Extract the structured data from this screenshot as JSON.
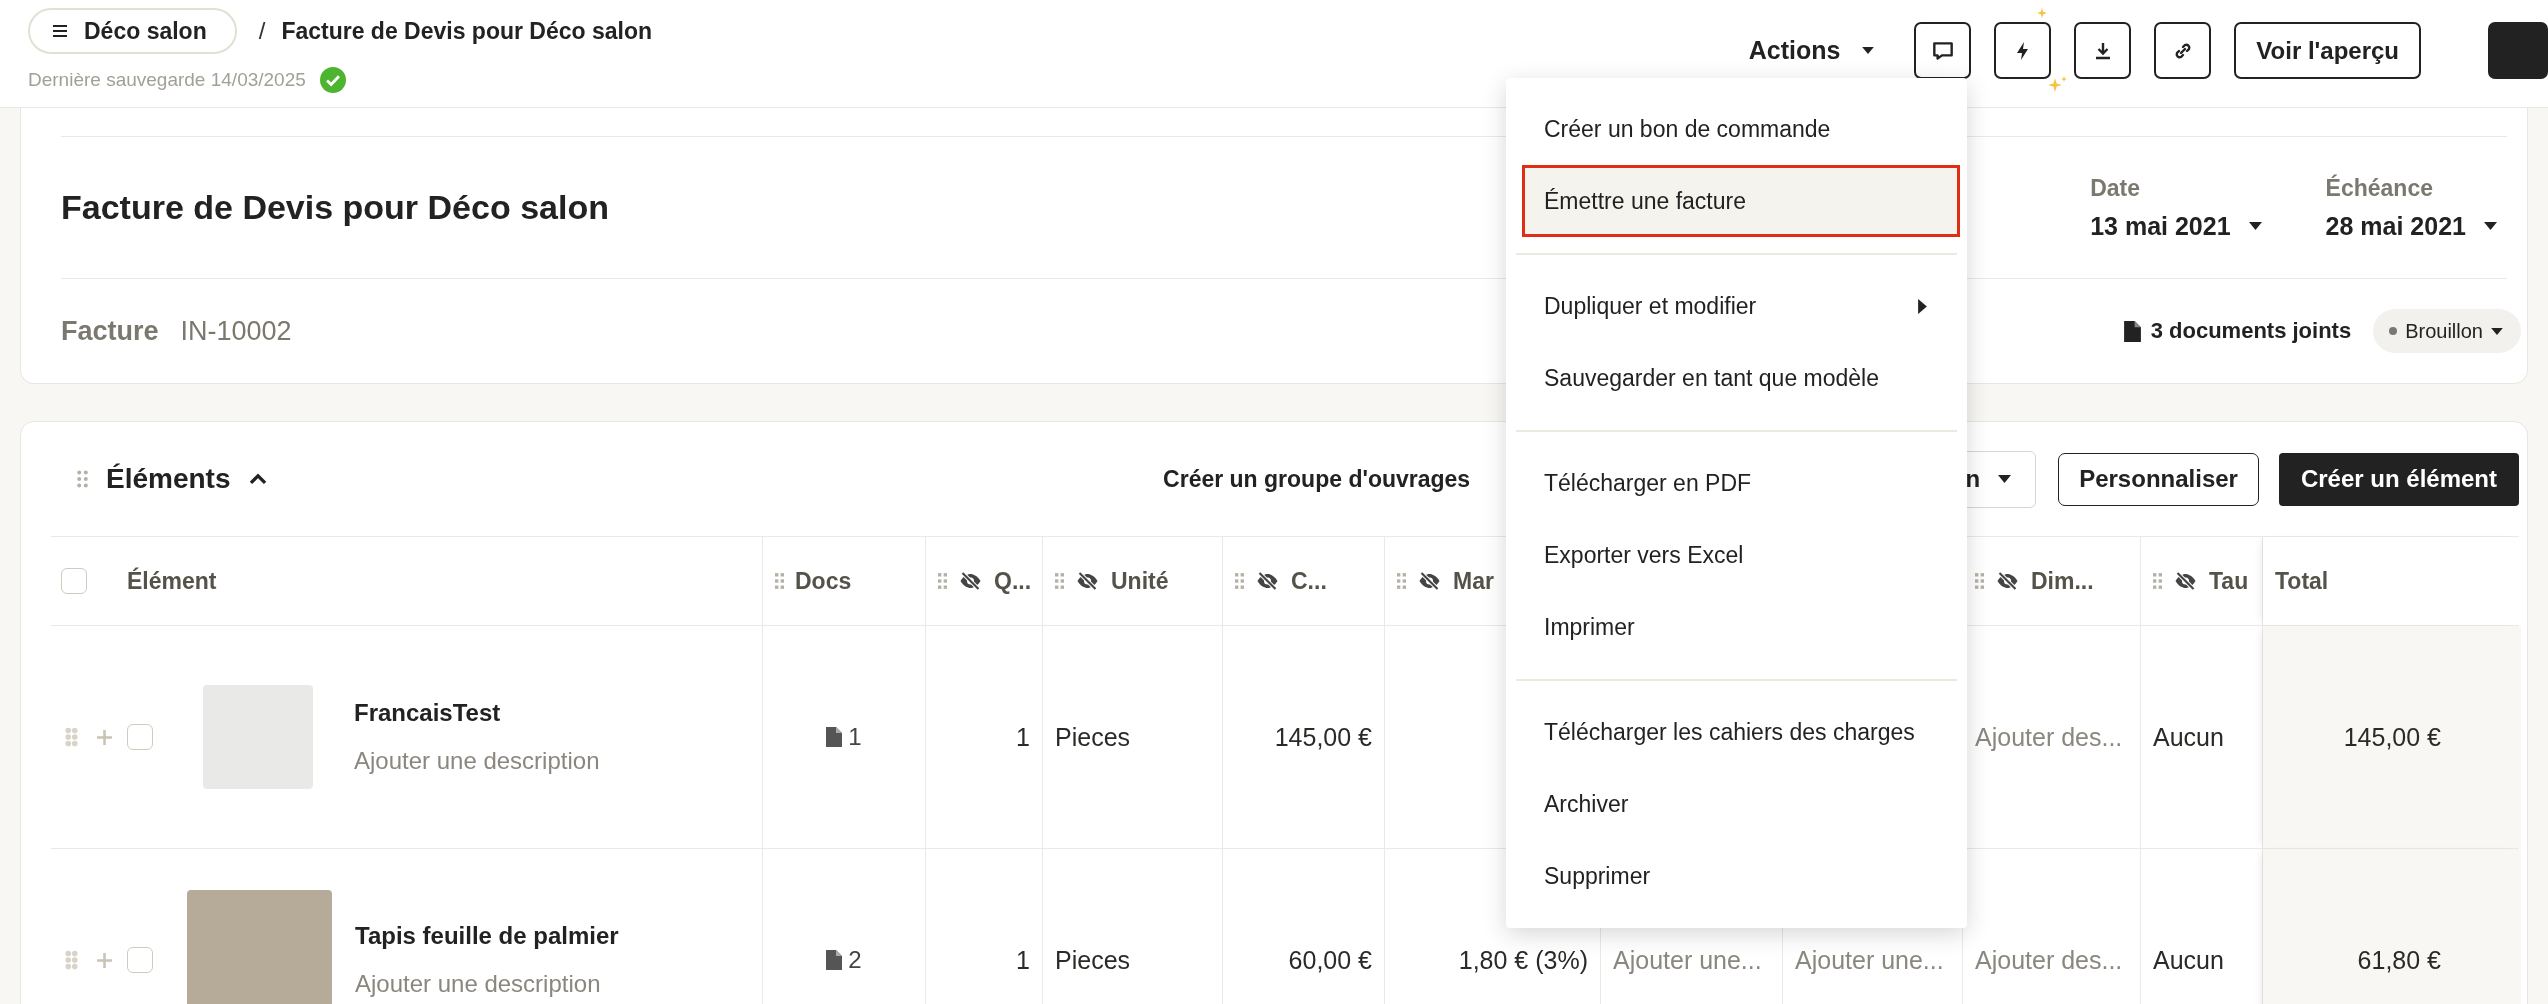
{
  "breadcrumb": {
    "project": "Déco salon",
    "separator": "/",
    "page": "Facture de Devis pour Déco salon"
  },
  "save_status": {
    "text": "Dernière sauvegarde 14/03/2025",
    "saved": true
  },
  "toolbar": {
    "actions": "Actions",
    "preview": "Voir l'aperçu"
  },
  "document": {
    "title": "Facture de Devis pour Déco salon",
    "type_label": "Facture",
    "number": "IN-10002",
    "date_label": "Date",
    "date": "13 mai 2021",
    "due_label": "Échéance",
    "due": "28 mai 2021",
    "attachments": "3 documents joints",
    "status": "Brouillon"
  },
  "elements": {
    "title": "Éléments",
    "expanded": true,
    "create_group": "Créer un groupe d'ouvrages",
    "covered_button": "n",
    "customize": "Personnaliser",
    "create": "Créer un élément",
    "select_all": {
      "checked": false
    },
    "columns": [
      {
        "label": "Élément",
        "draggable": false,
        "hidden": false
      },
      {
        "label": "Docs",
        "draggable": true,
        "hidden": false
      },
      {
        "label": "Q...",
        "draggable": true,
        "hidden": true
      },
      {
        "label": "Unité",
        "draggable": true,
        "hidden": true
      },
      {
        "label": "C...",
        "draggable": true,
        "hidden": true
      },
      {
        "label": "Mar",
        "draggable": true,
        "hidden": true
      },
      {},
      {},
      {
        "label": "Dim...",
        "draggable": true,
        "hidden": true
      },
      {
        "label": "Tau",
        "draggable": true,
        "hidden": true
      },
      {
        "label": "Total",
        "draggable": false,
        "hidden": false
      }
    ],
    "rows": [
      {
        "cells": [
          {
            "kind": "item",
            "name": "FrancaisTest",
            "description": "Ajouter une description",
            "checked": false
          },
          {
            "kind": "docs",
            "text": "1"
          },
          {
            "kind": "value",
            "text": "1"
          },
          {
            "kind": "value",
            "text": "Pieces"
          },
          {
            "kind": "value",
            "text": "145,00 €"
          },
          {},
          {},
          {},
          {
            "kind": "placeholder",
            "text": "Ajouter des..."
          },
          {
            "kind": "value",
            "text": "Aucun"
          },
          {
            "kind": "value",
            "text": "145,00 €"
          }
        ]
      },
      {
        "cells": [
          {
            "kind": "item",
            "name": "Tapis feuille de palmier",
            "description": "Ajouter une description",
            "checked": false
          },
          {
            "kind": "docs",
            "text": "2"
          },
          {
            "kind": "value",
            "text": "1"
          },
          {
            "kind": "value",
            "text": "Pieces"
          },
          {
            "kind": "value",
            "text": "60,00 €"
          },
          {
            "kind": "value",
            "text": "1,80 € (3%)"
          },
          {
            "kind": "placeholder",
            "text": "Ajouter une..."
          },
          {
            "kind": "placeholder",
            "text": "Ajouter une..."
          },
          {
            "kind": "placeholder",
            "text": "Ajouter des..."
          },
          {
            "kind": "value",
            "text": "Aucun"
          },
          {
            "kind": "value",
            "text": "61,80 €"
          }
        ]
      }
    ]
  },
  "actions_menu": {
    "groups": [
      [
        {
          "label": "Créer un bon de commande",
          "selected": false,
          "submenu": false
        },
        {
          "label": "Émettre une facture",
          "selected": true,
          "submenu": false
        }
      ],
      [
        {
          "label": "Dupliquer et modifier",
          "selected": false,
          "submenu": true
        },
        {
          "label": "Sauvegarder en tant que modèle",
          "selected": false,
          "submenu": false
        }
      ],
      [
        {
          "label": "Télécharger en PDF",
          "selected": false,
          "submenu": false
        },
        {
          "label": "Exporter vers Excel",
          "selected": false,
          "submenu": false
        },
        {
          "label": "Imprimer",
          "selected": false,
          "submenu": false
        }
      ],
      [
        {
          "label": "Télécharger les cahiers des charges",
          "selected": false,
          "submenu": false
        },
        {
          "label": "Archiver",
          "selected": false,
          "submenu": false
        },
        {
          "label": "Supprimer",
          "selected": false,
          "submenu": false
        }
      ]
    ]
  }
}
